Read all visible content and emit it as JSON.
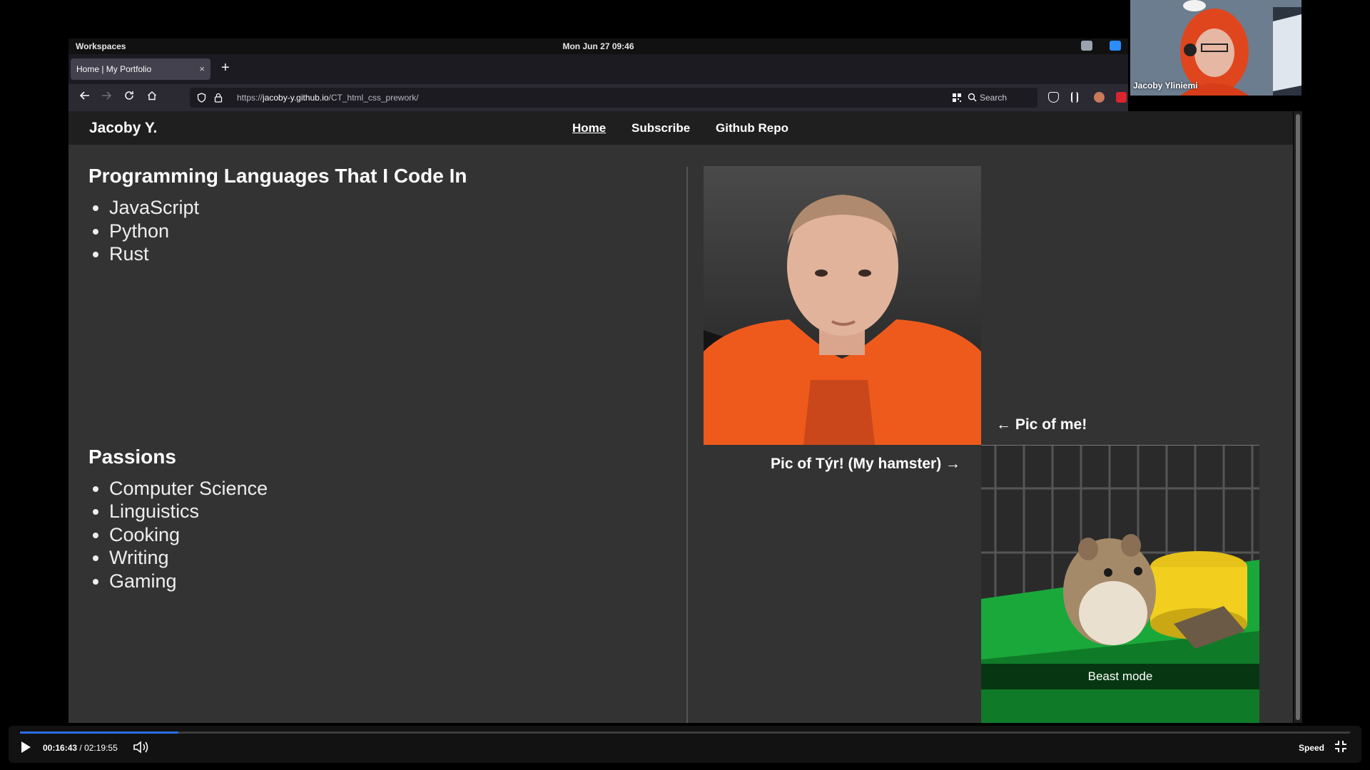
{
  "desktop": {
    "workspaces_label": "Workspaces",
    "clock": "Mon Jun 27  09:46"
  },
  "browser": {
    "tab_title": "Home | My Portfolio",
    "tab_close": "×",
    "new_tab": "+",
    "url_scheme": "https://",
    "url_host": "jacoby-y.github.io",
    "url_path": "/CT_html_css_prework/",
    "search_placeholder": "Search"
  },
  "site": {
    "brand": "Jacoby Y.",
    "nav": [
      {
        "label": "Home",
        "active": true
      },
      {
        "label": "Subscribe",
        "active": false
      },
      {
        "label": "Github Repo",
        "active": false
      }
    ],
    "languages": {
      "heading": "Programming Languages That I Code In",
      "items": [
        "JavaScript",
        "Python",
        "Rust"
      ]
    },
    "passions": {
      "heading": "Passions",
      "items": [
        "Computer Science",
        "Linguistics",
        "Cooking",
        "Writing",
        "Gaming"
      ]
    },
    "me_caption": "← Pic of me!",
    "hamster_caption": "Pic of Týr! (My hamster) →",
    "hamster_overlay": "Beast mode"
  },
  "webcam": {
    "participant_name": "Jacoby Yliniemi"
  },
  "player": {
    "current_time": "00:16:43",
    "separator": " / ",
    "total_time": "02:19:55",
    "progress_fraction": 0.119,
    "speed_label": "Speed"
  },
  "colors": {
    "page_bg": "#333333",
    "header_bg": "#1f1f1f",
    "accent_progress": "#2a6ee8",
    "hoodie_orange": "#ee5a1c"
  }
}
